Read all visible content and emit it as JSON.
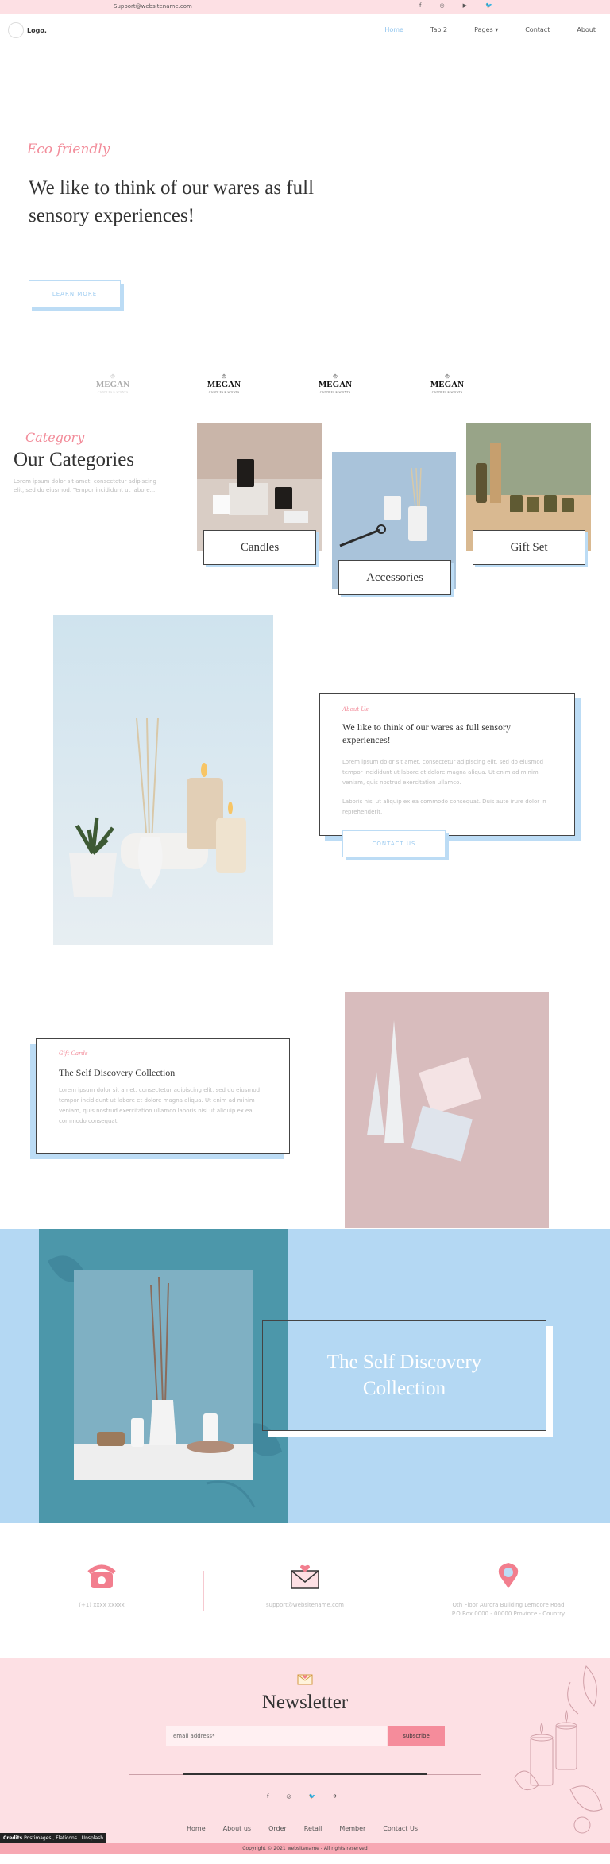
{
  "topbar": {
    "email": "Support@websitename.com",
    "socials": [
      "facebook-icon",
      "instagram-icon",
      "youtube-icon",
      "twitter-icon"
    ],
    "social_glyphs": [
      "f",
      "◎",
      "▶",
      "🐦"
    ]
  },
  "nav": {
    "logo": "Logo.",
    "items": [
      "Home",
      "Tab 2",
      "Pages ▾",
      "Contact",
      "About"
    ]
  },
  "hero": {
    "script": "Eco friendly",
    "heading": "We like to think of our wares as full sensory experiences!",
    "button": "LEARN MORE"
  },
  "brands": {
    "names": [
      "MEGAN",
      "MEGAN",
      "MEGAN",
      "MEGAN"
    ],
    "tagline": "CANDLES & SCENTS"
  },
  "categories": {
    "script": "Category",
    "heading": "Our Categories",
    "description": "Lorem ipsum dolor sit amet, consectetur adipiscing elit, sed do eiusmod. Tempor incididunt ut labore...",
    "items": [
      "Candles",
      "Accessories",
      "Gift Set"
    ]
  },
  "about": {
    "tag": "About Us",
    "title": "We like to think of our wares as full sensory experiences!",
    "text1": "Lorem ipsum dolor sit amet, consectetur adipiscing elit, sed do eiusmod tempor incididunt ut labore et dolore magna aliqua. Ut enim ad minim veniam, quis nostrud exercitation ullamco.",
    "text2": "Laboris nisi ut aliquip ex ea commodo consequat. Duis aute irure dolor in reprehenderit.",
    "button": "CONTACT US"
  },
  "discovery": {
    "tag": "Gift Cards",
    "title": "The Self Discovery Collection",
    "text": "Lorem ipsum dolor sit amet, consectetur adipiscing elit, sed do eiusmod tempor incididunt ut labore et dolore magna aliqua. Ut enim ad minim veniam, quis nostrud exercitation ullamco laboris nisi ut aliquip ex ea commodo consequat."
  },
  "banner": {
    "title": "The Self Discovery Collection"
  },
  "contact": {
    "phone": "(+1) xxxx xxxxx",
    "email": "support@websitename.com",
    "address_line1": "Oth Floor Aurora Building Lemoore Road",
    "address_line2": "P.O Box 0000 - 00000 Province - Country"
  },
  "newsletter": {
    "heading": "Newsletter",
    "placeholder": "email address*",
    "button": "subscribe",
    "socials": [
      "f",
      "◎",
      "🐦",
      "✈"
    ],
    "links": [
      "Home",
      "About us",
      "Order",
      "Retail",
      "Member",
      "Contact Us"
    ],
    "credits_label": "Credits",
    "credits_text": "Postimages , Flaticons , Unsplash",
    "copyright": "Copyright © 2021 websitename - All rights reserved"
  },
  "colors": {
    "pink": "#fde0e4",
    "accent_pink": "#f28b99",
    "light_blue": "#b4d8f3",
    "teal": "#4c97aa"
  }
}
